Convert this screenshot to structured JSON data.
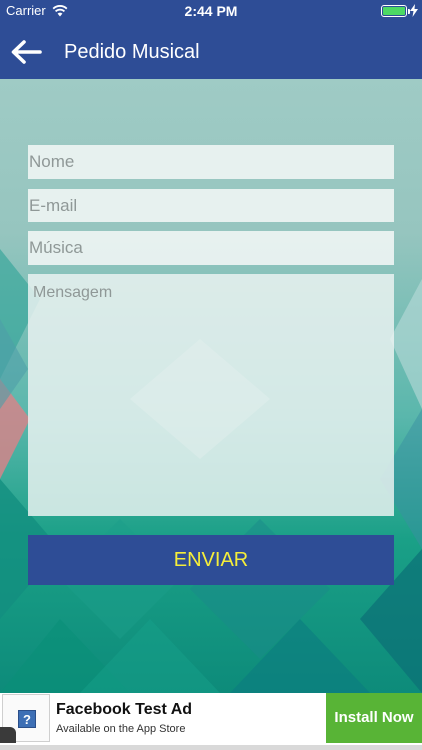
{
  "status_bar": {
    "carrier": "Carrier",
    "time": "2:44 PM"
  },
  "nav": {
    "title": "Pedido Musical",
    "back_icon": "back-arrow-icon"
  },
  "form": {
    "nome_placeholder": "Nome",
    "email_placeholder": "E-mail",
    "musica_placeholder": "Música",
    "mensagem_placeholder": "Mensagem",
    "send_label": "ENVIAR"
  },
  "ad": {
    "title": "Facebook Test Ad",
    "subtitle": "Available on the App Store",
    "install_label": "Install Now",
    "icon_glyph": "?"
  },
  "colors": {
    "header": "#2e4d96",
    "send_text": "#f5ee3a",
    "install": "#58b436"
  }
}
